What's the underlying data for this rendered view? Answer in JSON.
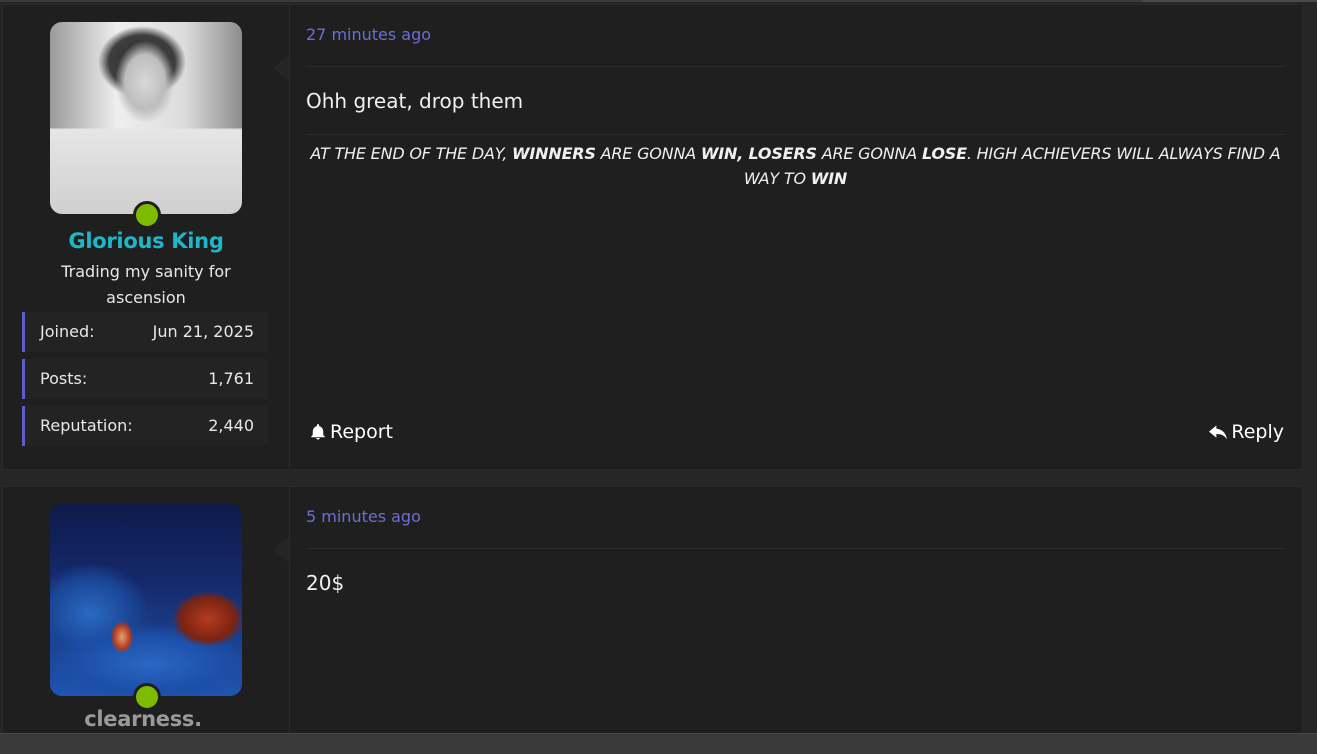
{
  "posts": [
    {
      "username": "Glorious King",
      "user_title": "Trading my sanity for ascension",
      "stats": [
        {
          "label": "Joined:",
          "value": "Jun 21, 2025"
        },
        {
          "label": "Posts:",
          "value": "1,761"
        },
        {
          "label": "Reputation:",
          "value": "2,440"
        }
      ],
      "timestamp": "27 minutes ago",
      "message": "Ohh great, drop them",
      "signature": {
        "parts": [
          {
            "text": "AT THE END OF THE DAY, ",
            "bold": false
          },
          {
            "text": "WINNERS",
            "bold": true
          },
          {
            "text": " ARE GONNA ",
            "bold": false
          },
          {
            "text": "WIN, LOSERS",
            "bold": true
          },
          {
            "text": " ARE GONNA ",
            "bold": false
          },
          {
            "text": "LOSE",
            "bold": true
          },
          {
            "text": ". HIGH ACHIEVERS WILL ALWAYS FIND A WAY TO ",
            "bold": false
          },
          {
            "text": "WIN",
            "bold": true
          }
        ]
      },
      "actions": {
        "report": "Report",
        "reply": "Reply"
      },
      "online": true
    },
    {
      "username": "clearness.",
      "timestamp": "5 minutes ago",
      "message": "20$",
      "online": true
    }
  ],
  "colors": {
    "accent": "#5b5fc7",
    "timestamp": "#6b6fd6",
    "username_highlight": "#1fb6c8",
    "online": "#7dbb00",
    "background": "#1f1f1f"
  },
  "icons": {
    "report": "bell-icon",
    "reply": "reply-arrow-icon"
  }
}
